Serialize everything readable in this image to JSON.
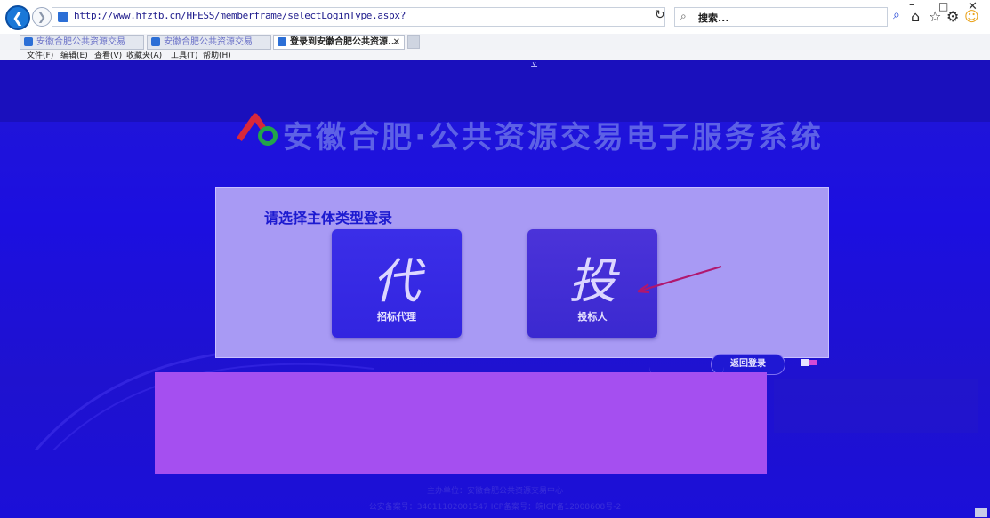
{
  "browser": {
    "url": "http://www.hfztb.cn/HFESS/memberframe/selectLoginType.aspx?",
    "search_placeholder": "搜索...",
    "tabs": [
      {
        "label": "安徽合肥公共资源交易",
        "active": false
      },
      {
        "label": "安徽合肥公共资源交易",
        "active": false
      },
      {
        "label": "登录到安徽合肥公共资源...",
        "active": true
      }
    ],
    "menu": [
      "文件(F)",
      "编辑(E)",
      "查看(V)",
      "收藏夹(A)",
      "工具(T)",
      "帮助(H)"
    ],
    "icons": [
      "back-icon",
      "forward-icon",
      "refresh-icon",
      "search-icon",
      "home-icon",
      "star-icon",
      "gear-icon",
      "smiley-icon"
    ]
  },
  "page": {
    "site_title": "安徽合肥·公共资源交易电子服务系统",
    "scroll_hint": "≚",
    "panel": {
      "title": "请选择主体类型登录",
      "cards": [
        {
          "glyph": "代",
          "label": "招标代理"
        },
        {
          "glyph": "投",
          "label": "投标人"
        }
      ],
      "back_button": "返回登录"
    },
    "footer": {
      "line1": "主办单位：安徽合肥公共资源交易中心",
      "line2": "公安备案号：34011102001547  ICP备案号：皖ICP备12008608号-2"
    },
    "colors": {
      "background": "#1d10d4",
      "panel": "#a89af4",
      "card": "#3b2ee8",
      "lower_panel": "#a54ff0",
      "arrow": "#b0176e"
    }
  }
}
